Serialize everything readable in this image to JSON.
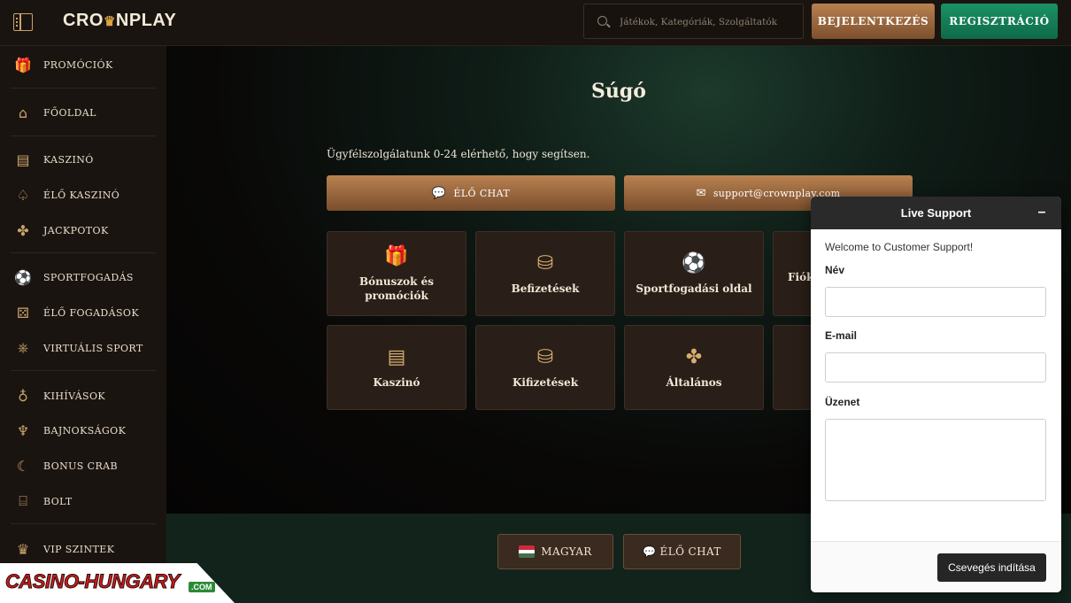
{
  "header": {
    "logo_left": "CRO",
    "logo_right": "NPLAY",
    "search_placeholder": "Játékok, Kategóriák, Szolgáltatók",
    "login_label": "BEJELENTKEZÉS",
    "register_label": "REGISZTRÁCIÓ"
  },
  "sidebar": {
    "items": [
      {
        "label": "PROMÓCIÓK",
        "icon": "gift-icon",
        "glyph": "🎁"
      },
      {
        "label": "FŐOLDAL",
        "icon": "home-icon",
        "glyph": "⌂"
      },
      {
        "label": "KASZINÓ",
        "icon": "slot-machine-icon",
        "glyph": "▤"
      },
      {
        "label": "ÉLŐ KASZINÓ",
        "icon": "spade-icon",
        "glyph": "♤"
      },
      {
        "label": "JACKPOTOK",
        "icon": "clover-icon",
        "glyph": "✤"
      },
      {
        "label": "SPORTFOGADÁS",
        "icon": "football-icon",
        "glyph": "⚽"
      },
      {
        "label": "ÉLŐ FOGADÁSOK",
        "icon": "live-betting-icon",
        "glyph": "⚄"
      },
      {
        "label": "VIRTUÁLIS SPORT",
        "icon": "gamepad-icon",
        "glyph": "⎈"
      },
      {
        "label": "KIHÍVÁSOK",
        "icon": "medal-icon",
        "glyph": "♁"
      },
      {
        "label": "BAJNOKSÁGOK",
        "icon": "trophy-icon",
        "glyph": "♆"
      },
      {
        "label": "BONUS CRAB",
        "icon": "crab-claw-icon",
        "glyph": "☾"
      },
      {
        "label": "BOLT",
        "icon": "shop-icon",
        "glyph": "⌸"
      },
      {
        "label": "VIP SZINTEK",
        "icon": "crown-icon",
        "glyph": "♛"
      }
    ]
  },
  "main": {
    "title": "Súgó",
    "intro": "Ügyfélszolgálatunk 0-24 elérhető, hogy segítsen.",
    "chat_button": "ÉLŐ CHAT",
    "email_button": "support@crownplay.com",
    "cards": [
      {
        "label": "Bónuszok és promóciók",
        "icon": "gift-icon",
        "glyph": "🎁"
      },
      {
        "label": "Befizetések",
        "icon": "coins-plus-icon",
        "glyph": "⛁"
      },
      {
        "label": "Sportfogadási oldal",
        "icon": "football-icon",
        "glyph": "⚽"
      },
      {
        "label": "Fiók",
        "icon": "account-icon",
        "glyph": ""
      },
      {
        "label": "Kaszinó",
        "icon": "slot-machine-icon",
        "glyph": "▤"
      },
      {
        "label": "Kifizetések",
        "icon": "coins-minus-icon",
        "glyph": "⛁"
      },
      {
        "label": "Általános",
        "icon": "clover-icon",
        "glyph": "✤"
      },
      {
        "label": "",
        "icon": "",
        "glyph": ""
      }
    ]
  },
  "footer": {
    "language_label": "MAGYAR",
    "chat_label": "ÉLŐ CHAT"
  },
  "watermark": {
    "text": "CASINO-HUNGARY",
    "suffix": ".COM"
  },
  "live_support": {
    "title": "Live Support",
    "minimize": "–",
    "welcome": "Welcome to Customer Support!",
    "name_label": "Név",
    "email_label": "E-mail",
    "message_label": "Üzenet",
    "name_value": "",
    "email_value": "",
    "message_value": "",
    "start_button": "Csevegés indítása"
  },
  "colors": {
    "accent_gold": "#c9a36a",
    "login_button": "#b88150",
    "register_button": "#1a9266",
    "live_support_header": "#2a2a2a"
  }
}
